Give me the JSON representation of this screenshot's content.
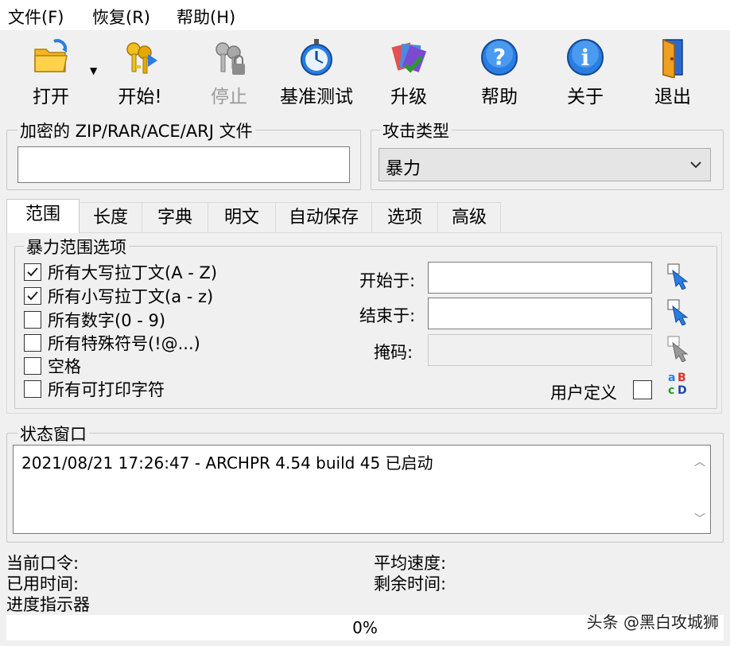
{
  "menu": [
    "文件(F)",
    "恢复(R)",
    "帮助(H)"
  ],
  "toolbar": {
    "buttons": [
      {
        "label": "打开",
        "icon": "folder-open-icon",
        "disabled": false
      },
      {
        "label": "开始!",
        "icon": "keys-icon",
        "disabled": false
      },
      {
        "label": "停止",
        "icon": "keys-lock-icon",
        "disabled": true
      },
      {
        "label": "基准测试",
        "icon": "stopwatch-icon",
        "disabled": false
      },
      {
        "label": "升级",
        "icon": "upgrade-icon",
        "disabled": false
      },
      {
        "label": "帮助",
        "icon": "help-icon",
        "disabled": false
      },
      {
        "label": "关于",
        "icon": "info-icon",
        "disabled": false
      },
      {
        "label": "退出",
        "icon": "exit-door-icon",
        "disabled": false
      }
    ]
  },
  "file_group": {
    "title": "加密的 ZIP/RAR/ACE/ARJ 文件",
    "value": ""
  },
  "attack_group": {
    "title": "攻击类型",
    "selected": "暴力"
  },
  "tabs": [
    "范围",
    "长度",
    "字典",
    "明文",
    "自动保存",
    "选项",
    "高级"
  ],
  "active_tab": 0,
  "range_group": {
    "title": "暴力范围选项",
    "checkboxes": [
      {
        "label": "所有大写拉丁文(A - Z)",
        "checked": true
      },
      {
        "label": "所有小写拉丁文(a - z)",
        "checked": true
      },
      {
        "label": "所有数字(0 - 9)",
        "checked": false
      },
      {
        "label": "所有特殊符号(!@...)",
        "checked": false
      },
      {
        "label": "空格",
        "checked": false
      },
      {
        "label": "所有可打印字符",
        "checked": false
      }
    ],
    "start_label": "开始于:",
    "start_value": "",
    "end_label": "结束于:",
    "end_value": "",
    "mask_label": "掩码:",
    "mask_value": "",
    "user_defined_label": "用户定义",
    "user_defined_checked": false,
    "charset_icon_text": "aBcD"
  },
  "status_group": {
    "title": "状态窗口",
    "log": "2021/08/21 17:26:47 - ARCHPR 4.54 build 45 已启动"
  },
  "info": {
    "current_password": "当前口令:",
    "elapsed_time": "已用时间:",
    "progress_indicator": "进度指示器",
    "average_speed": "平均速度:",
    "remaining_time": "剩余时间:"
  },
  "progress": {
    "percent": 0,
    "text": "0%"
  },
  "watermark": "头条 @黑白攻城狮",
  "colors": {
    "accent_blue": "#1e6fd9",
    "checkbox_border": "#333333",
    "progress_green": "#06b025"
  }
}
